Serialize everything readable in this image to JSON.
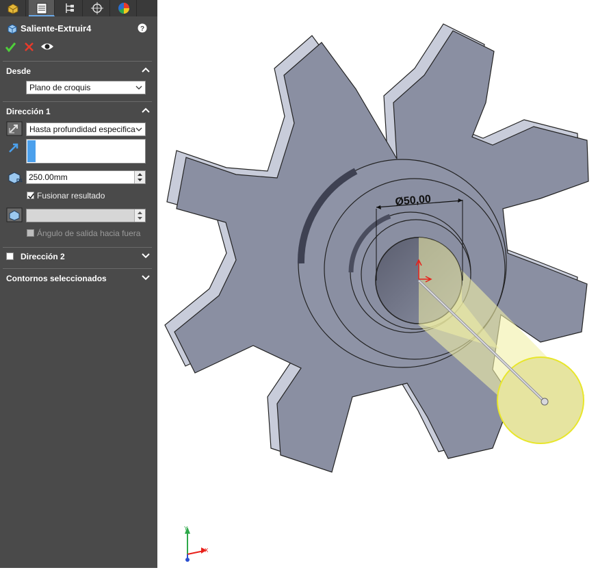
{
  "panel": {
    "title": "Saliente-Extruir4",
    "tabs": [
      "featuremanager-icon",
      "propertymanager-icon",
      "configurationmanager-icon",
      "dimxpert-icon",
      "display-manager-icon"
    ],
    "desde": {
      "label": "Desde",
      "start_condition": "Plano de croquis"
    },
    "direccion1": {
      "label": "Dirección 1",
      "end_condition": "Hasta profundidad especifica",
      "depth": "250.00mm",
      "merge_label": "Fusionar resultado",
      "merge_checked": true,
      "draft_label": "Ángulo de salida hacia fuera",
      "draft_checked": false
    },
    "direccion2": {
      "label": "Dirección 2",
      "checked": false
    },
    "contornos": {
      "label": "Contornos seleccionados"
    }
  },
  "viewport": {
    "dimension_label": "Ø50,00",
    "triad": {
      "x_label": "X",
      "y_label": "Y"
    }
  },
  "colors": {
    "panel_bg": "#4a4a4a",
    "gear_face": "#8a8fa2",
    "gear_side": "#c8ccda",
    "preview_yellow": "#f2f0a6",
    "accent_blue": "#4ba0ec"
  }
}
